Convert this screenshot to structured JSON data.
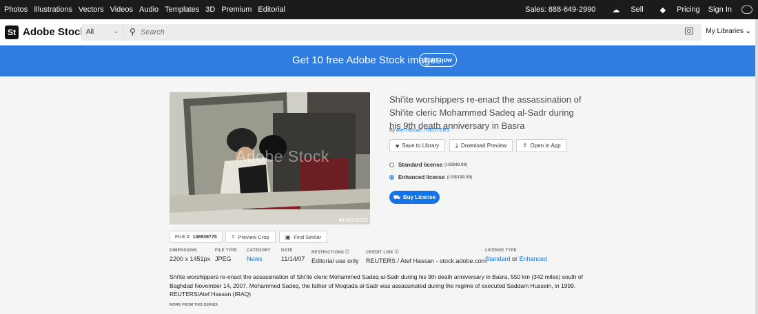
{
  "topnav": {
    "links": [
      "Photos",
      "Illustrations",
      "Vectors",
      "Videos",
      "Audio",
      "Templates",
      "3D",
      "Premium",
      "Editorial"
    ],
    "sales": "Sales: 888-649-2990",
    "sell": "Sell",
    "pricing": "Pricing",
    "signin": "Sign In"
  },
  "header": {
    "logo_mark": "St",
    "logo_text": "Adobe Stock",
    "filter": "All",
    "search_placeholder": "Search",
    "my_libraries": "My Libraries"
  },
  "banner": {
    "text": "Get 10 free Adobe Stock images.",
    "button": "Start now"
  },
  "asset": {
    "watermark": "Adobe Stock",
    "image_id": "#146939775",
    "title": "Shi'ite worshippers re-enact the assassination of Shi'ite cleric Mohammed Sadeq al-Sadr during his 9th death anniversary in Basra",
    "by_prefix": "By",
    "by_author": "Atef Hassan / REUTERS",
    "actions": {
      "save": "Save to Library",
      "download": "Download Preview",
      "open": "Open in App"
    },
    "licenses": [
      {
        "name": "Standard license",
        "price": "(US$49.99)",
        "selected": false
      },
      {
        "name": "Enhanced license",
        "price": "(US$199.99)",
        "selected": true
      }
    ],
    "buy_label": "Buy License",
    "file_label": "FILE #:",
    "file_number": "146939775",
    "preview_crop": "Preview Crop",
    "find_similar": "Find Similar",
    "meta": {
      "dimensions": {
        "h": "DIMENSIONS",
        "v": "2200 x 1451px"
      },
      "file_type": {
        "h": "FILE TYPE",
        "v": "JPEG"
      },
      "category": {
        "h": "CATEGORY",
        "v": "News"
      },
      "date": {
        "h": "DATE",
        "v": "11/14/07"
      },
      "restrictions": {
        "h": "RESTRICTIONS",
        "v": "Editorial use only"
      },
      "credit": {
        "h": "CREDIT LINE",
        "v": "REUTERS / Atef Hassan - stock.adobe.com"
      },
      "license_type": {
        "h": "LICENSE TYPE",
        "standard": "Standard",
        "or": "or",
        "enhanced": "Enhanced"
      }
    },
    "description": "Shi'ite worshippers re-enact the assassination of Shi'ite cleric Mohammed Sadeq al-Sadr during his 9th death anniversary in Basra, 550 km (342 miles) south of Baghdad November 14, 2007. Mohammed Sadeq, the father of Moqtada al-Sadr was assassinated during the regime of executed Saddam Hussein, in 1999. REUTERS/Atef Hassan (IRAQ)",
    "more_label": "MORE FROM THIS SERIES"
  },
  "colors": {
    "accent": "#1473e6",
    "banner": "#2f7de0",
    "topnav": "#1b1b1b"
  }
}
